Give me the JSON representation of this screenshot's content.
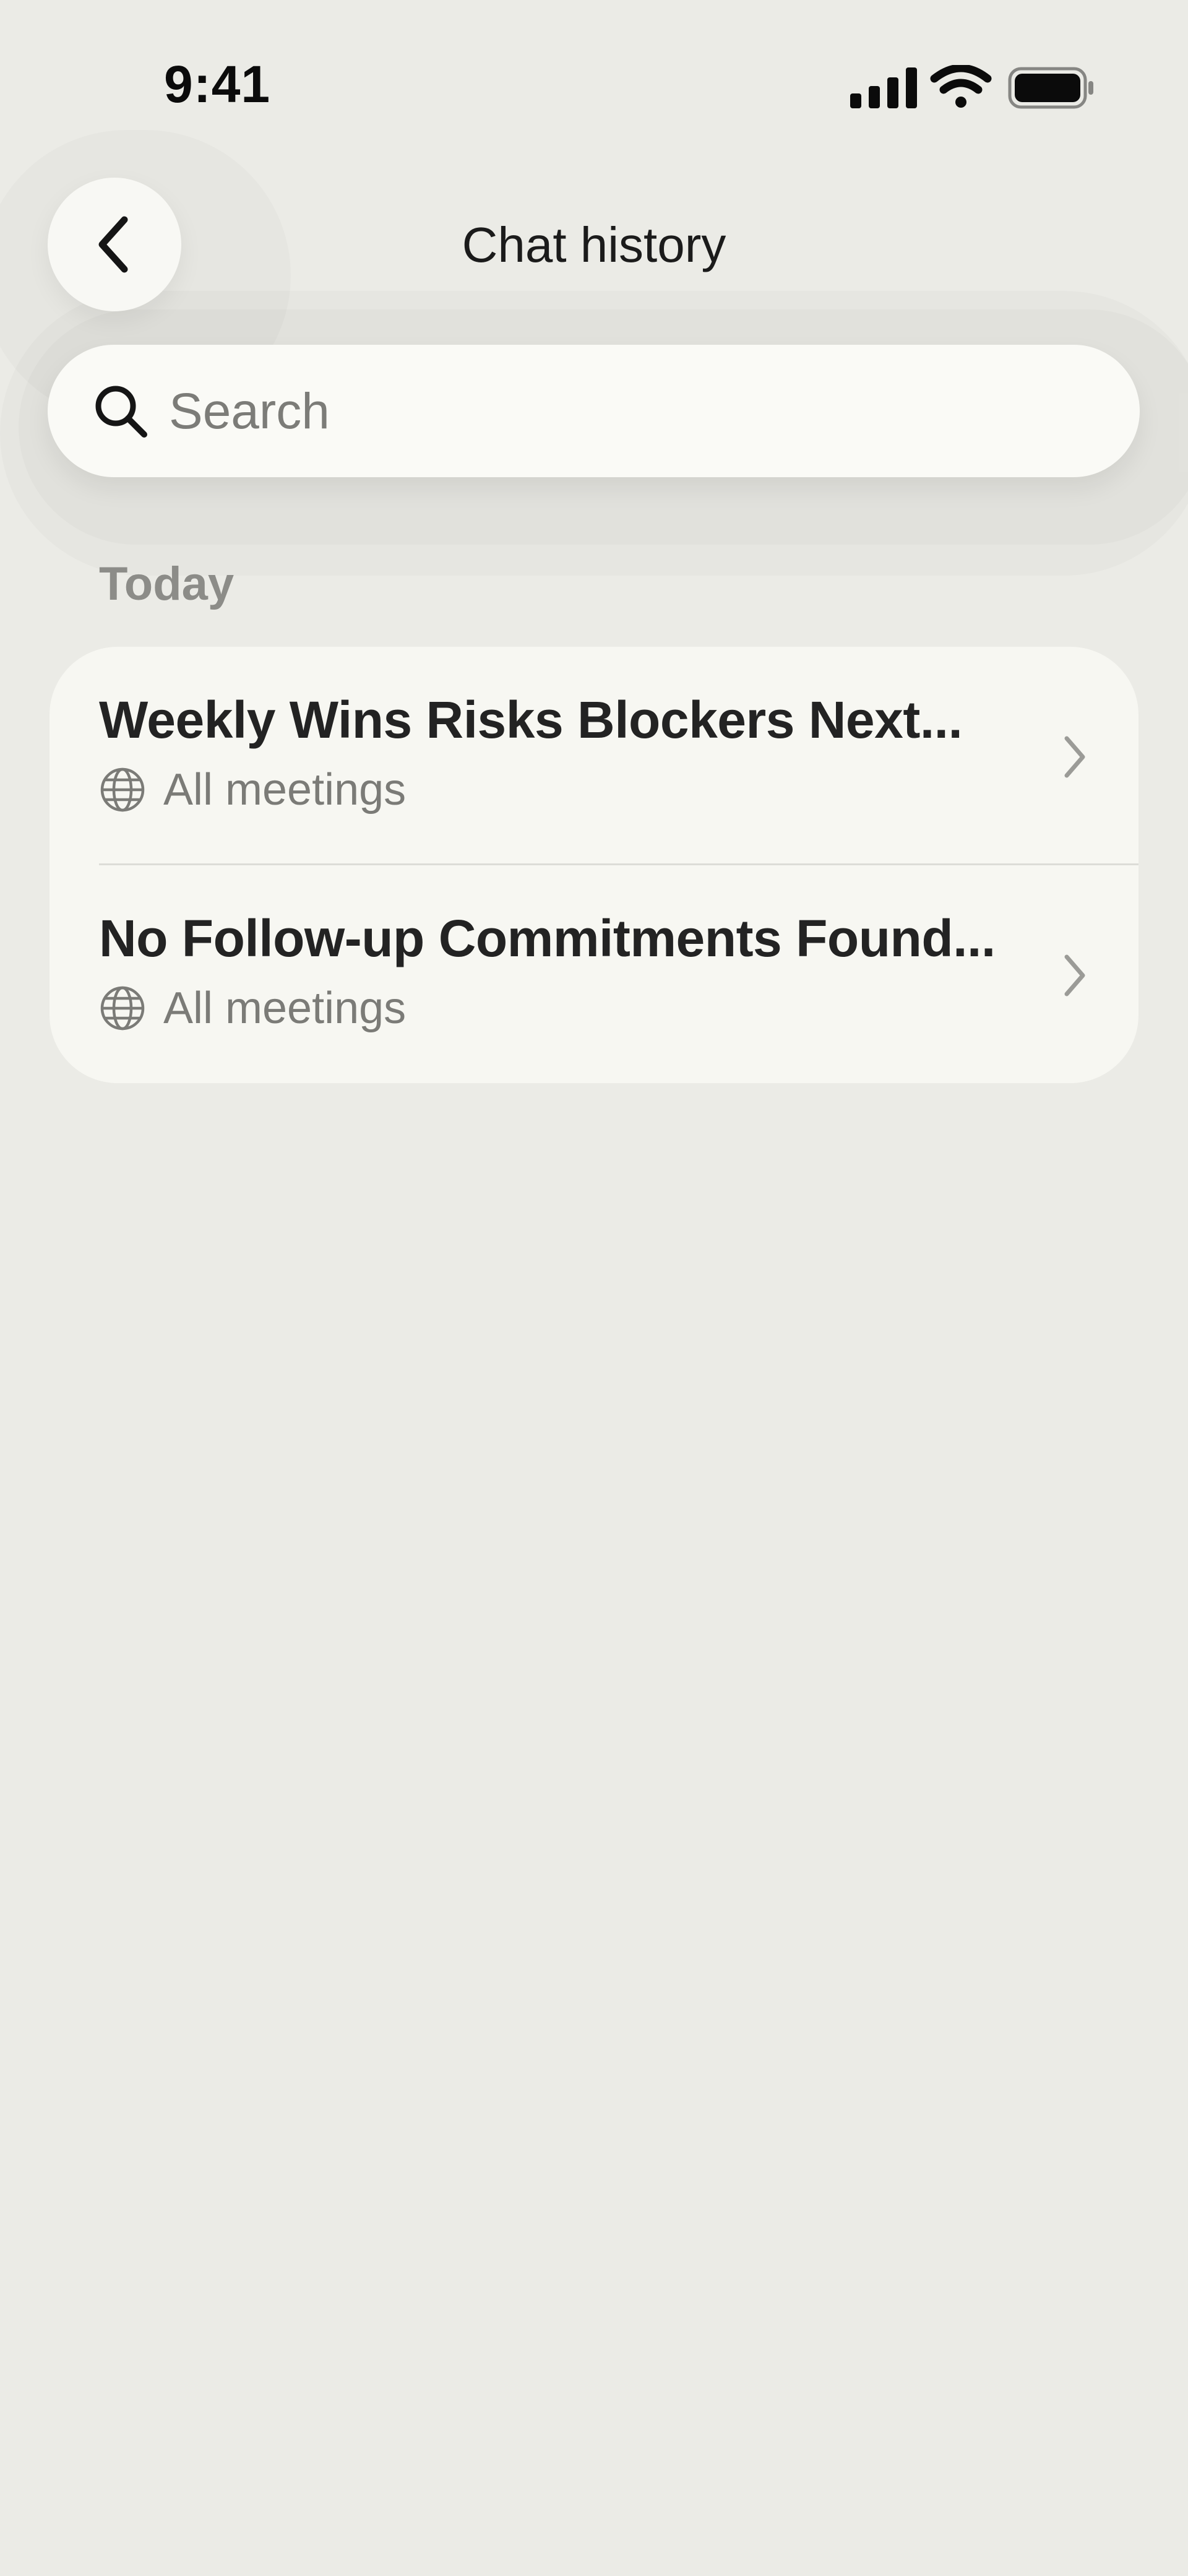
{
  "status_bar": {
    "time": "9:41",
    "icons": [
      "signal-icon",
      "wifi-icon",
      "battery-icon"
    ]
  },
  "header": {
    "back_icon": "chevron-left-icon",
    "title": "Chat history"
  },
  "search": {
    "placeholder": "Search",
    "value": "",
    "icon": "search-icon"
  },
  "sections": [
    {
      "label": "Today",
      "items": [
        {
          "title": "Weekly Wins Risks Blockers Next...",
          "subtitle": "All meetings",
          "icon": "globe-icon"
        },
        {
          "title": "No Follow-up Commitments Found...",
          "subtitle": "All meetings",
          "icon": "globe-icon"
        }
      ]
    }
  ],
  "colors": {
    "background": "#ebebe6",
    "card": "#f7f7f2",
    "primary_text": "#232323",
    "secondary_text": "#7b7b77",
    "section_label": "#8c8c88"
  }
}
